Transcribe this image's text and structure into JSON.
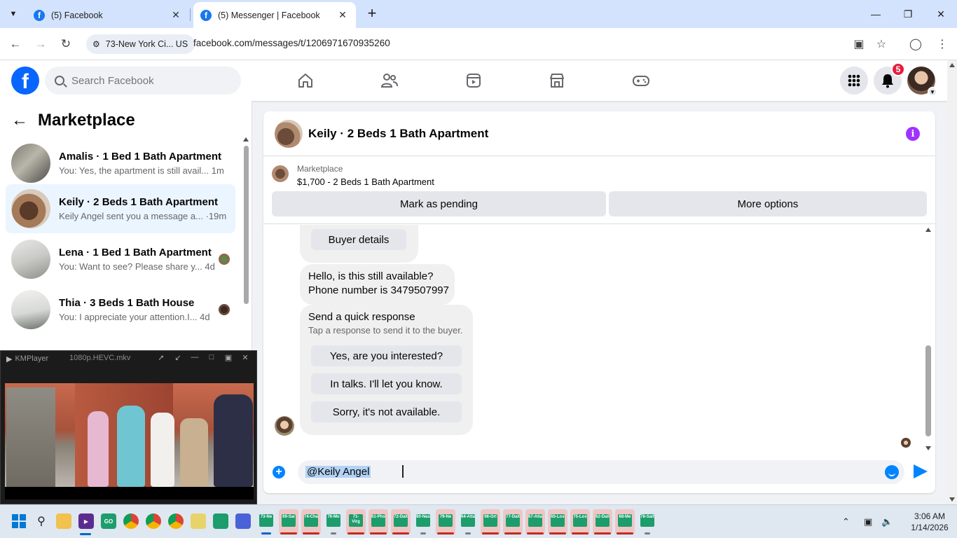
{
  "browser": {
    "tabs": [
      {
        "title": "(5) Facebook",
        "active": false
      },
      {
        "title": "(5) Messenger | Facebook",
        "active": true
      }
    ],
    "site_chip": "73-New York Ci... US",
    "url": "facebook.com/messages/t/1206971670935260"
  },
  "fb": {
    "search_placeholder": "Search Facebook",
    "notification_count": "5",
    "brand_color": "#0866ff"
  },
  "sidebar": {
    "title": "Marketplace",
    "conversations": [
      {
        "name": "Amalis · 1 Bed 1 Bath Apartment",
        "preview": "You: Yes, the apartment is still avail...",
        "time": "1m",
        "selected": false
      },
      {
        "name": "Keily · 2 Beds 1 Bath Apartment",
        "preview": "Keily Angel sent you a message a...",
        "time": "·19m",
        "selected": true
      },
      {
        "name": "Lena · 1 Bed 1 Bath Apartment",
        "preview": "You: Want to see? Please share y...",
        "time": "4d",
        "selected": false
      },
      {
        "name": "Thia · 3 Beds 1 Bath House",
        "preview": "You: I appreciate your attention.I...",
        "time": "4d",
        "selected": false
      }
    ]
  },
  "kmplayer": {
    "app": "KMPlayer",
    "file": "1080p.HEVC.mkv"
  },
  "chat": {
    "title": "Keily · 2 Beds 1 Bath Apartment",
    "listing_source": "Marketplace",
    "listing": "$1,700 - 2 Beds 1 Bath Apartment",
    "mark_pending": "Mark as pending",
    "more_options": "More options",
    "buyer_details": "Buyer details",
    "message_line1": "Hello, is this still available?",
    "message_line2": "Phone number is 3479507997",
    "quick_title": "Send a quick response",
    "quick_subtitle": "Tap a response to send it to the buyer.",
    "quick_options": [
      "Yes, are you interested?",
      "In talks. I'll let you know.",
      "Sorry, it's not available."
    ],
    "composer_text": "@Keily Angel",
    "accent_color": "#0084ff"
  },
  "taskbar": {
    "groups": [
      "73-Ne",
      "69-Sai",
      "74-Cha",
      "76-Mo",
      "71-Virg",
      "61-Pho",
      "72-Dall",
      "80-Nas",
      "79-Ne",
      "64-Atla",
      "66-Orl",
      "77-Dall",
      "67-Atla",
      "65-Los",
      "75-Los",
      "62-Dall",
      "68-Me",
      "78-Salt"
    ],
    "time": "3:06 AM",
    "date": "1/14/2026"
  }
}
